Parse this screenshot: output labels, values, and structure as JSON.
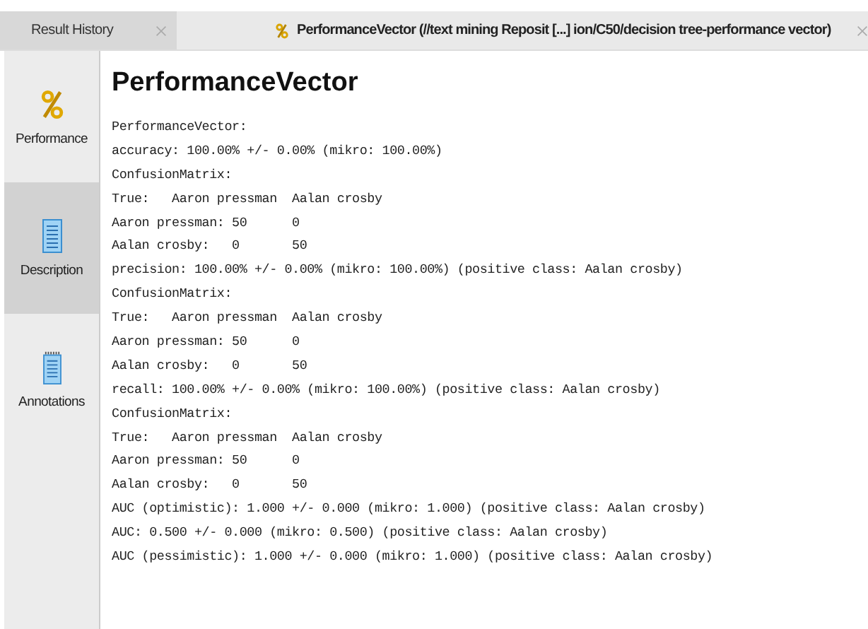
{
  "tabs": [
    {
      "label": "Result History",
      "selected": false,
      "icon": false
    },
    {
      "label": "PerformanceVector (//text mining Reposit [...] ion/C50/decision tree-performance vector)",
      "selected": true,
      "icon": true
    }
  ],
  "sidebar": {
    "items": [
      {
        "label": "Performance",
        "kind": "percent",
        "selected": false
      },
      {
        "label": "Description",
        "kind": "document",
        "selected": true
      },
      {
        "label": "Annotations",
        "kind": "notes",
        "selected": false
      }
    ]
  },
  "title": "PerformanceVector",
  "lines": [
    "PerformanceVector:",
    "accuracy: 100.00% +/- 0.00% (mikro: 100.00%)",
    "ConfusionMatrix:",
    "True:   Aaron pressman  Aalan crosby",
    "Aaron pressman: 50      0",
    "Aalan crosby:   0       50",
    "precision: 100.00% +/- 0.00% (mikro: 100.00%) (positive class: Aalan crosby)",
    "ConfusionMatrix:",
    "True:   Aaron pressman  Aalan crosby",
    "Aaron pressman: 50      0",
    "Aalan crosby:   0       50",
    "recall: 100.00% +/- 0.00% (mikro: 100.00%) (positive class: Aalan crosby)",
    "ConfusionMatrix:",
    "True:   Aaron pressman  Aalan crosby",
    "Aaron pressman: 50      0",
    "Aalan crosby:   0       50",
    "AUC (optimistic): 1.000 +/- 0.000 (mikro: 1.000) (positive class: Aalan crosby)",
    "AUC: 0.500 +/- 0.000 (mikro: 0.500) (positive class: Aalan crosby)",
    "AUC (pessimistic): 1.000 +/- 0.000 (mikro: 1.000) (positive class: Aalan crosby)"
  ]
}
